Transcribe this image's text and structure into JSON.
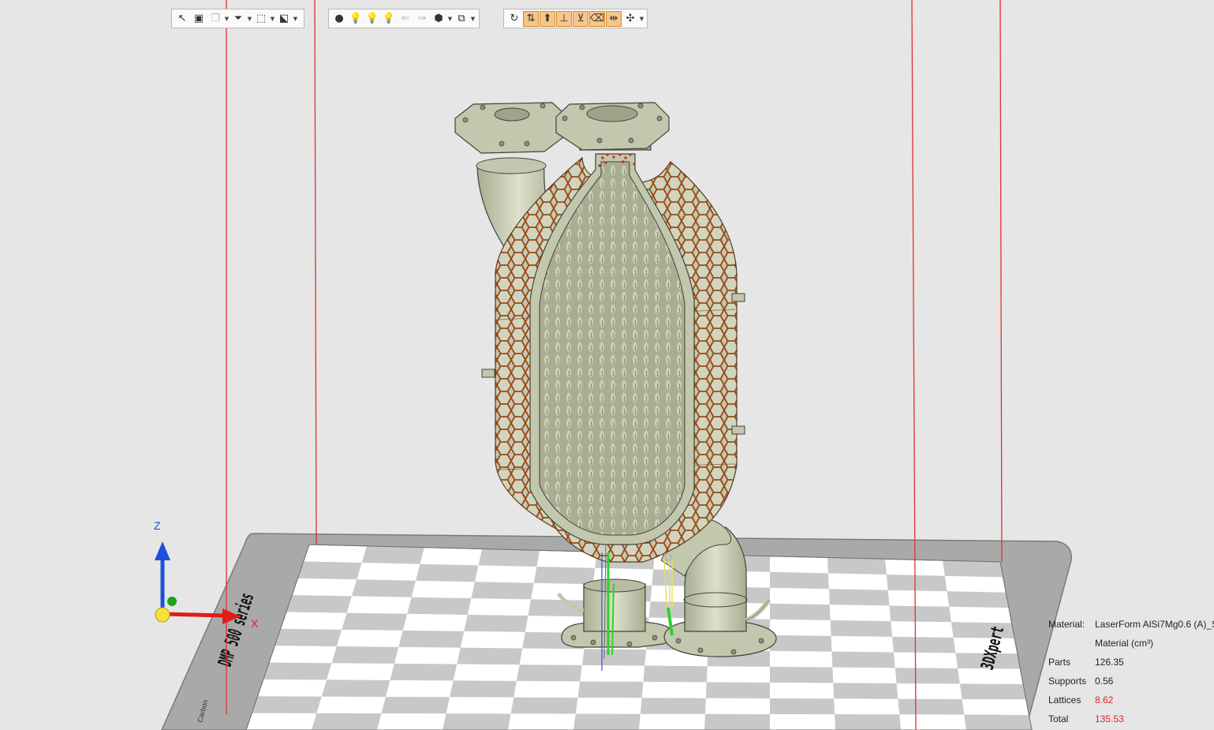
{
  "viewport": {
    "plate_brand_left": "DMP 500 series",
    "plate_brand_right": "3DXpert",
    "plate_corner_text": "Carbon",
    "axis_labels": {
      "z": "Z",
      "x": "X"
    }
  },
  "toolbars": {
    "selection": [
      {
        "icon": "select-arrow-icon",
        "glyph": "↖"
      },
      {
        "icon": "select-box-icon",
        "glyph": "▣"
      },
      {
        "icon": "select-parts-icon",
        "glyph": "❒",
        "dim": true,
        "caret": true
      },
      {
        "icon": "filter-select-icon",
        "glyph": "⏷",
        "caret": true
      },
      {
        "icon": "rect-select-icon",
        "glyph": "⬚",
        "caret": true
      },
      {
        "icon": "region-select-icon",
        "glyph": "⬕",
        "caret": true
      }
    ],
    "view": [
      {
        "icon": "light-off-icon",
        "glyph": "●"
      },
      {
        "icon": "light-bulb-icon",
        "glyph": "💡"
      },
      {
        "icon": "light-dim-icon",
        "glyph": "💡",
        "dim": true
      },
      {
        "icon": "light-dim2-icon",
        "glyph": "💡",
        "dim": true
      },
      {
        "icon": "arrow-left-icon",
        "glyph": "⇐",
        "dim": true
      },
      {
        "icon": "arrow-right-icon",
        "glyph": "⇒",
        "dim": true
      },
      {
        "icon": "cube-view-icon",
        "glyph": "⬢",
        "caret": true
      },
      {
        "icon": "section-view-icon",
        "glyph": "⧉",
        "caret": true
      }
    ],
    "tools": [
      {
        "icon": "rotate-icon",
        "glyph": "↻"
      },
      {
        "icon": "distribute-icon",
        "glyph": "⇅",
        "active": true
      },
      {
        "icon": "lift-part-icon",
        "glyph": "⬆",
        "active": true
      },
      {
        "icon": "place-on-face-icon",
        "glyph": "⊥",
        "active": true
      },
      {
        "icon": "align-icon",
        "glyph": "⊻",
        "active": true
      },
      {
        "icon": "erase-icon",
        "glyph": "⌫",
        "active": true
      },
      {
        "icon": "position-icon",
        "glyph": "⇹",
        "active": true
      },
      {
        "icon": "move-axes-icon",
        "glyph": "✣",
        "caret": true
      }
    ]
  },
  "material_info": {
    "material_label": "Material:",
    "material_value": "LaserForm AlSi7Mg0.6 (A)_S",
    "volume_label": "Material (cm³)",
    "rows": [
      {
        "label": "Parts",
        "value": "126.35"
      },
      {
        "label": "Supports",
        "value": "0.56"
      },
      {
        "label": "Lattices",
        "value": "8.62",
        "highlight": true
      },
      {
        "label": "Total",
        "value": "135.53",
        "highlight": true
      }
    ]
  },
  "colors": {
    "background": "#e6e6e6",
    "part": "#c2c7ad",
    "lattice": "#a14e1c",
    "build_box_edge": "#e03030",
    "plate_frame": "#a9a9a9",
    "plate_tile_dark": "#c8c8c8",
    "plate_tile_light": "#ffffff",
    "axis_z": "#1d4fd8",
    "axis_x": "#e21b1b",
    "axis_origin": "#f5e23a",
    "supports": "#2fd12f",
    "highlight_value": "#e02020"
  }
}
